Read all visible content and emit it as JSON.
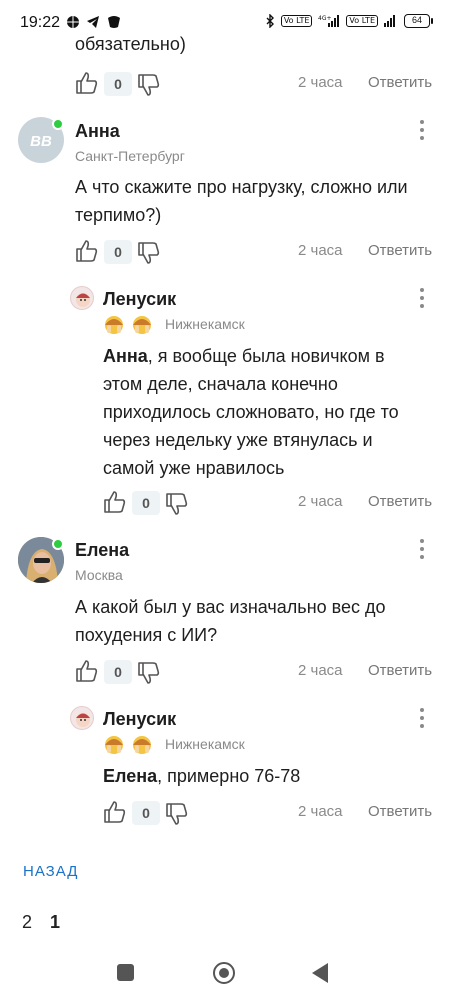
{
  "status_bar": {
    "time": "19:22",
    "network_label": "4G+",
    "lte_label": "Vo LTE",
    "battery": "64"
  },
  "top_comment_tail": {
    "text": "обязательно)",
    "votes": "0",
    "time": "2 часа",
    "reply": "Ответить"
  },
  "comments": [
    {
      "author": "Анна",
      "city": "Санкт-Петербург",
      "avatar_initials": "ВВ",
      "avatar_color": "#c8d4da",
      "text_lines": [
        "А что скажите про нагрузку, сложно или",
        "терпимо?)"
      ],
      "votes": "0",
      "time": "2 часа",
      "reply": "Ответить"
    },
    {
      "author": "Ленусик",
      "city": "Нижнекамск",
      "mention": "Анна",
      "text_lines": [
        ", я вообще была новичком в",
        "этом деле, сначала конечно",
        "приходилось сложновато, но где то",
        "через недельку уже втянулась и",
        "самой уже нравилось"
      ],
      "votes": "0",
      "time": "2 часа",
      "reply": "Ответить"
    },
    {
      "author": "Елена",
      "city": "Москва",
      "text_lines": [
        "А какой был у вас изначально вес до",
        "похудения с ИИ?"
      ],
      "votes": "0",
      "time": "2 часа",
      "reply": "Ответить"
    },
    {
      "author": "Ленусик",
      "city": "Нижнекамск",
      "mention": "Елена",
      "text_lines": [
        ", примерно 76-78"
      ],
      "votes": "0",
      "time": "2 часа",
      "reply": "Ответить"
    }
  ],
  "footer": {
    "back": "НАЗАД",
    "pages": [
      "2",
      "1"
    ]
  },
  "colors": {
    "accent": "#1a73c9",
    "online": "#2ecc40",
    "muted": "#8a8a8a"
  }
}
